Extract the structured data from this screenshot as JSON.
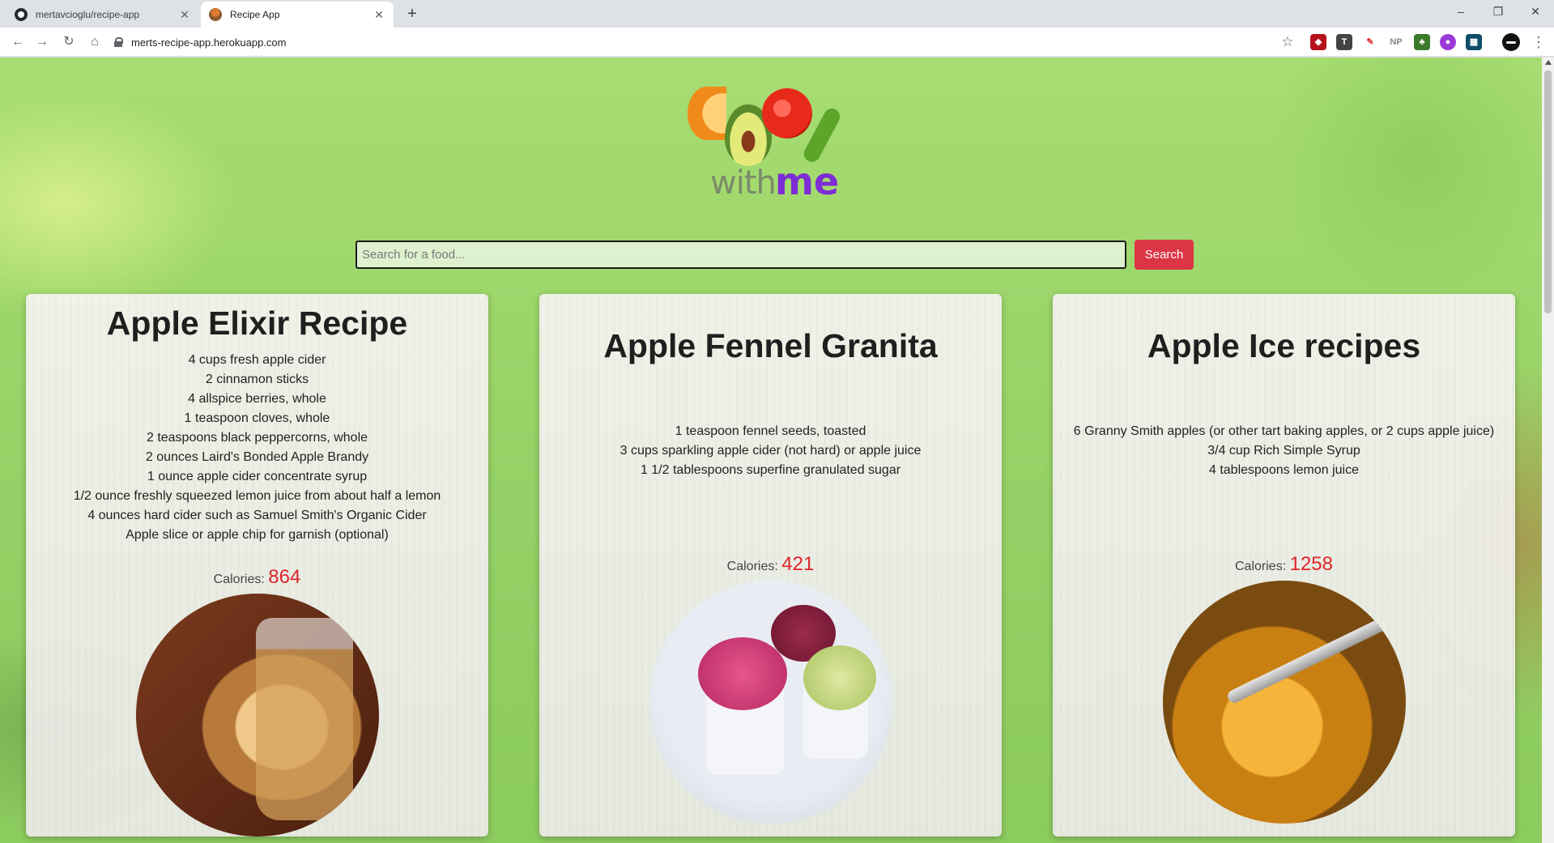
{
  "browser": {
    "tabs": [
      {
        "title": "mertavcioglu/recipe-app",
        "active": false
      },
      {
        "title": "Recipe App",
        "active": true
      }
    ],
    "new_tab": "+",
    "url": "merts-recipe-app.herokuapp.com",
    "extensions": [
      "uBlock",
      "T",
      "pen",
      "NP",
      "leaf",
      "purple",
      "grid"
    ],
    "window_controls": {
      "minimize": "–",
      "restore": "❐",
      "close": "✕"
    }
  },
  "logo": {
    "word1": "with",
    "word2": "me"
  },
  "search": {
    "placeholder": "Search for a food...",
    "button_label": "Search"
  },
  "calories_label": "Calories:",
  "recipes": [
    {
      "title": "Apple Elixir Recipe",
      "ingredients": [
        "4 cups fresh apple cider",
        "2 cinnamon sticks",
        "4 allspice berries, whole",
        "1 teaspoon cloves, whole",
        "2 teaspoons black peppercorns, whole",
        "2 ounces Laird's Bonded Apple Brandy",
        "1 ounce apple cider concentrate syrup",
        "1/2 ounce freshly squeezed lemon juice from about half a lemon",
        "4 ounces hard cider such as Samuel Smith's Organic Cider",
        "Apple slice or apple chip for garnish (optional)"
      ],
      "calories": "864"
    },
    {
      "title": "Apple Fennel Granita",
      "ingredients": [
        "1 teaspoon fennel seeds, toasted",
        "3 cups sparkling apple cider (not hard) or apple juice",
        "1 1/2 tablespoons superfine granulated sugar"
      ],
      "calories": "421"
    },
    {
      "title": "Apple Ice recipes",
      "ingredients": [
        "6 Granny Smith apples (or other tart baking apples, or 2 cups apple juice)",
        "3/4 cup Rich Simple Syrup",
        "4 tablespoons lemon juice"
      ],
      "calories": "1258"
    }
  ],
  "colors": {
    "search_button": "#dc3545",
    "calories_number": "#e0242b",
    "logo_me": "#7d2dd6"
  }
}
